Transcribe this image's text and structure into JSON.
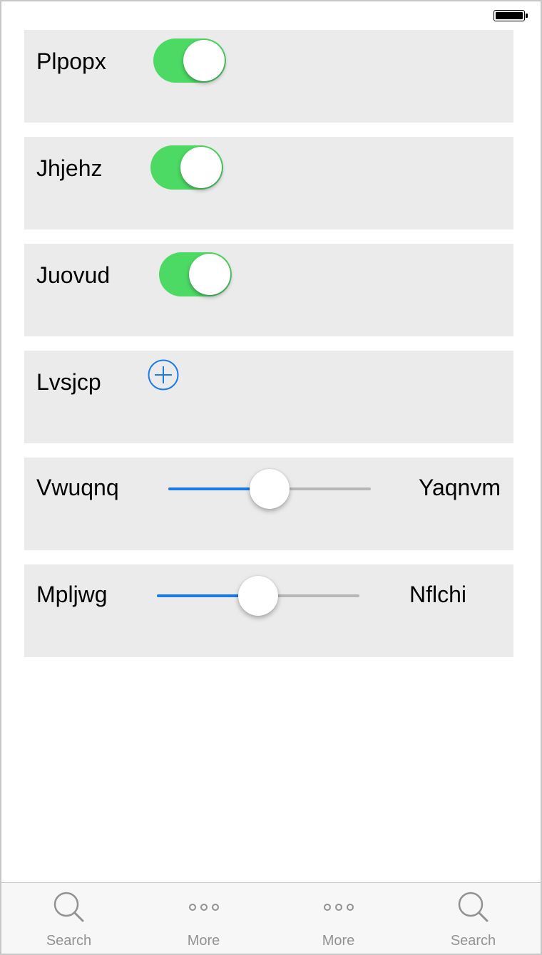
{
  "rows": [
    {
      "label": "Plpopx",
      "control": "toggle",
      "on": true
    },
    {
      "label": "Jhjehz",
      "control": "toggle",
      "on": true
    },
    {
      "label": "Juovud",
      "control": "toggle",
      "on": true
    },
    {
      "label": "Lvsjcp",
      "control": "add-icon"
    },
    {
      "label": "Vwuqnq",
      "control": "slider",
      "value": 0.5,
      "right_label": "Yaqnvm"
    },
    {
      "label": "Mpljwg",
      "control": "slider",
      "value": 0.5,
      "right_label": "Nflchi"
    }
  ],
  "tab_bar": {
    "tabs": [
      {
        "label": "Search",
        "icon": "search-icon"
      },
      {
        "label": "More",
        "icon": "more-icon"
      },
      {
        "label": "More",
        "icon": "more-icon"
      },
      {
        "label": "Search",
        "icon": "search-icon"
      }
    ]
  },
  "colors": {
    "toggle_on": "#4cd964",
    "accent": "#1a7ae8",
    "card_bg": "#ebebeb",
    "tab_inactive": "#929292"
  }
}
